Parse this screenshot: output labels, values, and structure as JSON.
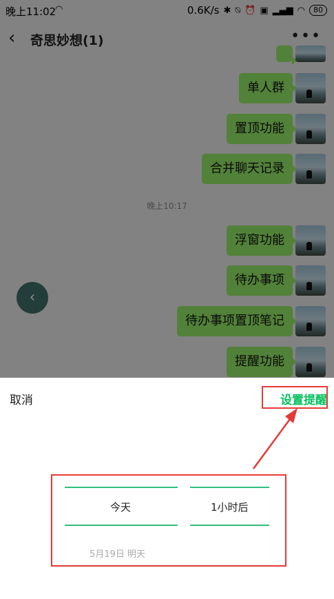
{
  "status_bar": {
    "time": "晚上11:02",
    "speed": "0.6K/s",
    "battery": "80"
  },
  "header": {
    "title": "奇思妙想(1)"
  },
  "messages": [
    {
      "text": "单人群"
    },
    {
      "text": "置顶功能"
    },
    {
      "text": "合并聊天记录"
    },
    {
      "text": "浮窗功能"
    },
    {
      "text": "待办事项"
    },
    {
      "text": "待办事项置顶笔记"
    },
    {
      "text": "提醒功能"
    }
  ],
  "timestamp": "晚上10:17",
  "sheet": {
    "cancel_label": "取消",
    "confirm_label": "设置提醒",
    "picker": {
      "day": "今天",
      "offset": "1小时后",
      "next_option": "5月19日 明天"
    }
  },
  "colors": {
    "accent": "#07c160",
    "bubble": "#95ec69",
    "annotation": "#e53935"
  }
}
